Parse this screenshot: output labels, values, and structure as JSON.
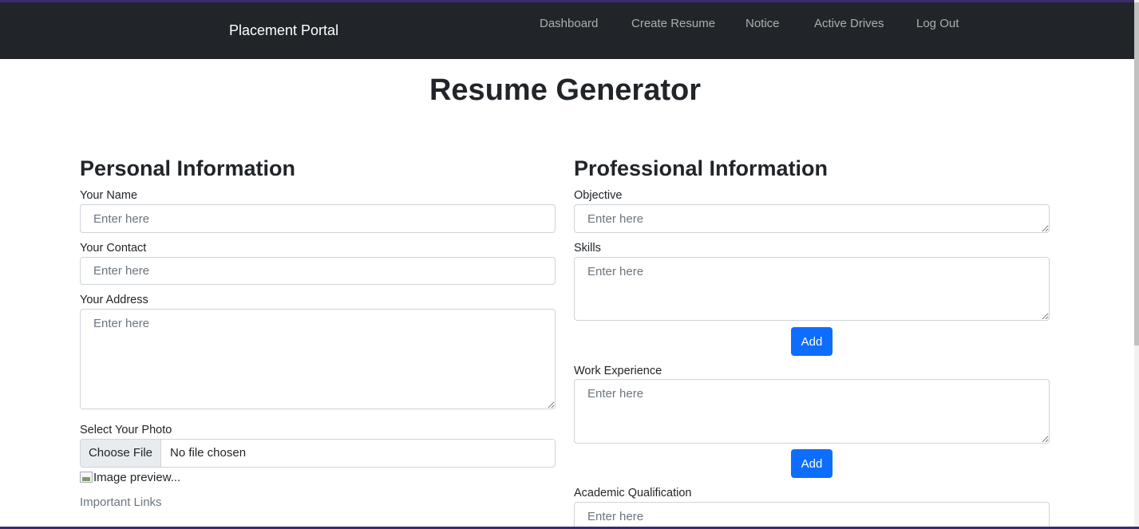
{
  "navbar": {
    "brand": "Placement Portal",
    "links": [
      "Dashboard",
      "Create Resume",
      "Notice",
      "Active Drives",
      "Log Out"
    ]
  },
  "page": {
    "title": "Resume Generator"
  },
  "personal": {
    "title": "Personal Information",
    "name": {
      "label": "Your Name",
      "placeholder": "Enter here"
    },
    "contact": {
      "label": "Your Contact",
      "placeholder": "Enter here"
    },
    "address": {
      "label": "Your Address",
      "placeholder": "Enter here"
    },
    "photo": {
      "label": "Select Your Photo",
      "button": "Choose File",
      "status": "No file chosen"
    },
    "preview_alt": "Image preview...",
    "links_label": "Important Links"
  },
  "professional": {
    "title": "Professional Information",
    "objective": {
      "label": "Objective",
      "placeholder": "Enter here"
    },
    "skills": {
      "label": "Skills",
      "placeholder": "Enter here",
      "button": "Add"
    },
    "work": {
      "label": "Work Experience",
      "placeholder": "Enter here",
      "button": "Add"
    },
    "academic": {
      "label": "Academic Qualification",
      "placeholder": "Enter here"
    }
  },
  "colors": {
    "navbar": "#212529",
    "primary": "#0d6efd",
    "accent": "#3b2a6e"
  }
}
